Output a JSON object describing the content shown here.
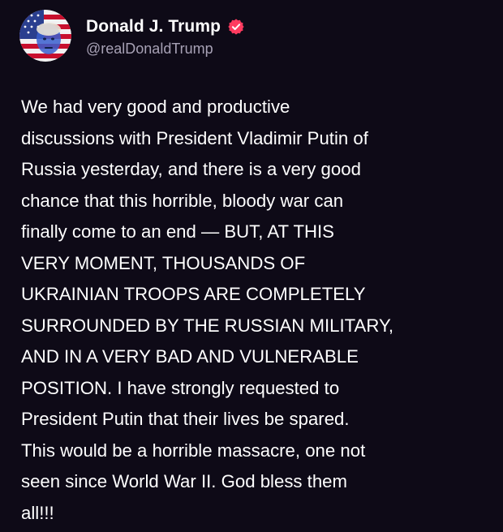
{
  "post": {
    "author": {
      "display_name": "Donald J. Trump",
      "handle": "@realDonaldTrump",
      "verified": true,
      "avatar_icon": "user-avatar-flag",
      "verified_icon": "verified-badge-icon",
      "verified_color": "#ff3b5f"
    },
    "body_lines": [
      "We had very good and productive",
      "discussions with President Vladimir Putin of",
      "Russia yesterday, and there is a very good",
      "chance that this horrible, bloody war can",
      "finally come to an end — BUT, AT THIS",
      "VERY MOMENT, THOUSANDS OF",
      "UKRAINIAN TROOPS ARE COMPLETELY",
      "SURROUNDED BY THE RUSSIAN MILITARY,",
      "AND IN A VERY BAD AND VULNERABLE",
      "POSITION. I have strongly requested to",
      "President Putin that their lives be spared.",
      "This would be a horrible massacre, one not",
      "seen since World War II. God bless them",
      "all!!!"
    ]
  },
  "colors": {
    "background": "#0e0a17",
    "text": "#ffffff",
    "handle": "#a7a1b5"
  }
}
